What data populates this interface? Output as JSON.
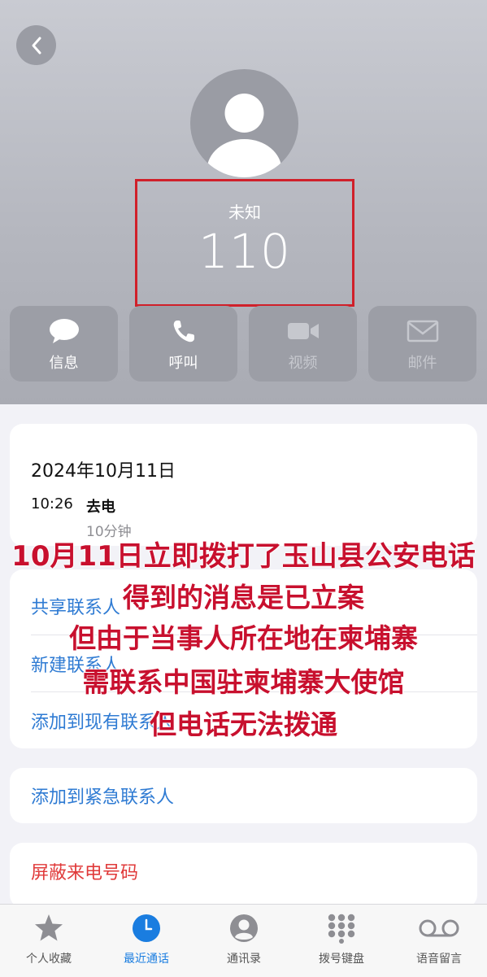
{
  "header": {
    "back_icon": "chevron-left-icon",
    "avatar_icon": "person-silhouette-icon",
    "caller_name": "未知",
    "caller_number": "110",
    "highlight_color": "#d0202a"
  },
  "actions": [
    {
      "label": "信息",
      "icon": "message-bubble-icon",
      "enabled": true
    },
    {
      "label": "呼叫",
      "icon": "phone-icon",
      "enabled": true
    },
    {
      "label": "视频",
      "icon": "video-camera-icon",
      "enabled": false
    },
    {
      "label": "邮件",
      "icon": "envelope-icon",
      "enabled": false
    }
  ],
  "call_log": {
    "date": "2024年10月11日",
    "time": "10:26",
    "type": "去电",
    "duration": "10分钟"
  },
  "contact_actions": [
    "共享联系人",
    "新建联系人",
    "添加到现有联系人"
  ],
  "emergency_action": "添加到紧急联系人",
  "block_action": "屏蔽来电号码",
  "overlay_text": [
    "10月11日立即拨打了玉山县公安电话",
    "得到的消息是已立案",
    "但由于当事人所在地在柬埔寨",
    "需联系中国驻柬埔寨大使馆",
    "但电话无法拨通"
  ],
  "tabbar": [
    {
      "label": "个人收藏",
      "icon": "star-icon",
      "active": false
    },
    {
      "label": "最近通话",
      "icon": "clock-icon",
      "active": true
    },
    {
      "label": "通讯录",
      "icon": "contact-circle-icon",
      "active": false
    },
    {
      "label": "拨号键盘",
      "icon": "keypad-icon",
      "active": false
    },
    {
      "label": "语音留言",
      "icon": "voicemail-icon",
      "active": false
    }
  ],
  "colors": {
    "link_blue": "#2f7bd3",
    "destructive_red": "#e03a3a",
    "active_tab": "#1a7de0",
    "overlay_red": "#c8102e"
  }
}
